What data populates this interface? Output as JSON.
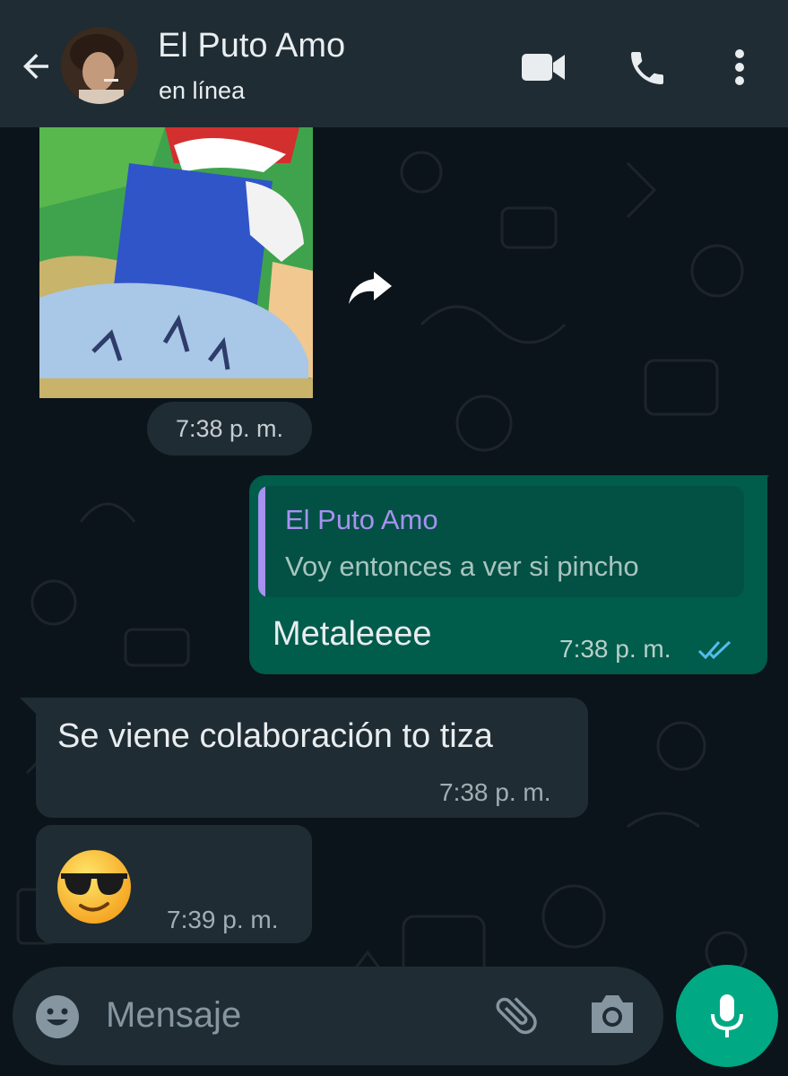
{
  "header": {
    "contact_name": "El Puto Amo",
    "status": "en línea",
    "icons": [
      "back-arrow-icon",
      "video-call-icon",
      "phone-icon",
      "more-options-icon"
    ]
  },
  "messages": [
    {
      "type": "image",
      "direction": "incoming",
      "time": "7:38 p. m."
    },
    {
      "type": "text",
      "direction": "outgoing",
      "quoted_author": "El Puto Amo",
      "quoted_text": "Voy entonces a ver si pincho",
      "text": "Metaleeee",
      "time": "7:38 p. m.",
      "status": "read"
    },
    {
      "type": "text",
      "direction": "incoming",
      "text": "Se viene colaboración to tiza",
      "time": "7:38 p. m."
    },
    {
      "type": "emoji",
      "direction": "incoming",
      "emoji_name": "smiling-face-with-sunglasses",
      "time": "7:39 p. m."
    }
  ],
  "composer": {
    "placeholder": "Mensaje",
    "icons": [
      "emoji-icon",
      "attach-icon",
      "camera-icon",
      "mic-icon"
    ]
  },
  "colors": {
    "background": "#0b141a",
    "header": "#1f2c34",
    "outgoing_bubble": "#005c4b",
    "incoming_bubble": "#1f2c34",
    "quote_accent": "#a791f1",
    "read_ticks": "#53bdeb",
    "mic_button": "#00a884"
  }
}
